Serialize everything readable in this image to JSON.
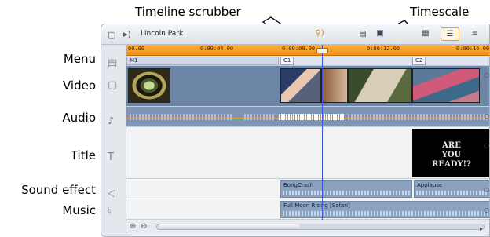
{
  "callouts": {
    "scrubber": "Timeline scrubber",
    "timescale": "Timescale"
  },
  "row_labels": [
    "Menu",
    "Video",
    "Audio",
    "Title",
    "Sound effect",
    "Music"
  ],
  "toolbar": {
    "project_name": "Lincoln Park",
    "project_icon": "movie-project-icon",
    "volume_icon": "speaker-icon",
    "keyframe_icon": "key-audio-icon",
    "storyboard_icon": "storyboard-view-icon",
    "timeline_icon": "timeline-view-icon",
    "text_view_icon": "text-view-icon"
  },
  "ruler": {
    "ticks": [
      "00.00",
      "0:00:04.00",
      "0:00:08.00",
      "0:00:12.00",
      "0:00:16.00"
    ]
  },
  "markers": [
    "M1",
    "C1",
    "C2"
  ],
  "title_clip": {
    "lines": [
      "ARE",
      "YOU",
      "READY!?"
    ]
  },
  "sound_effects": [
    {
      "name": "BongCrash"
    },
    {
      "name": "Applause"
    }
  ],
  "music": [
    {
      "name": "Full Moon Rising [Safari]"
    }
  ],
  "colors": {
    "ruler": "#f29118",
    "scrubber": "#3b55d8",
    "video_track": "#6e86a6",
    "audio_track": "#7f95b3"
  }
}
